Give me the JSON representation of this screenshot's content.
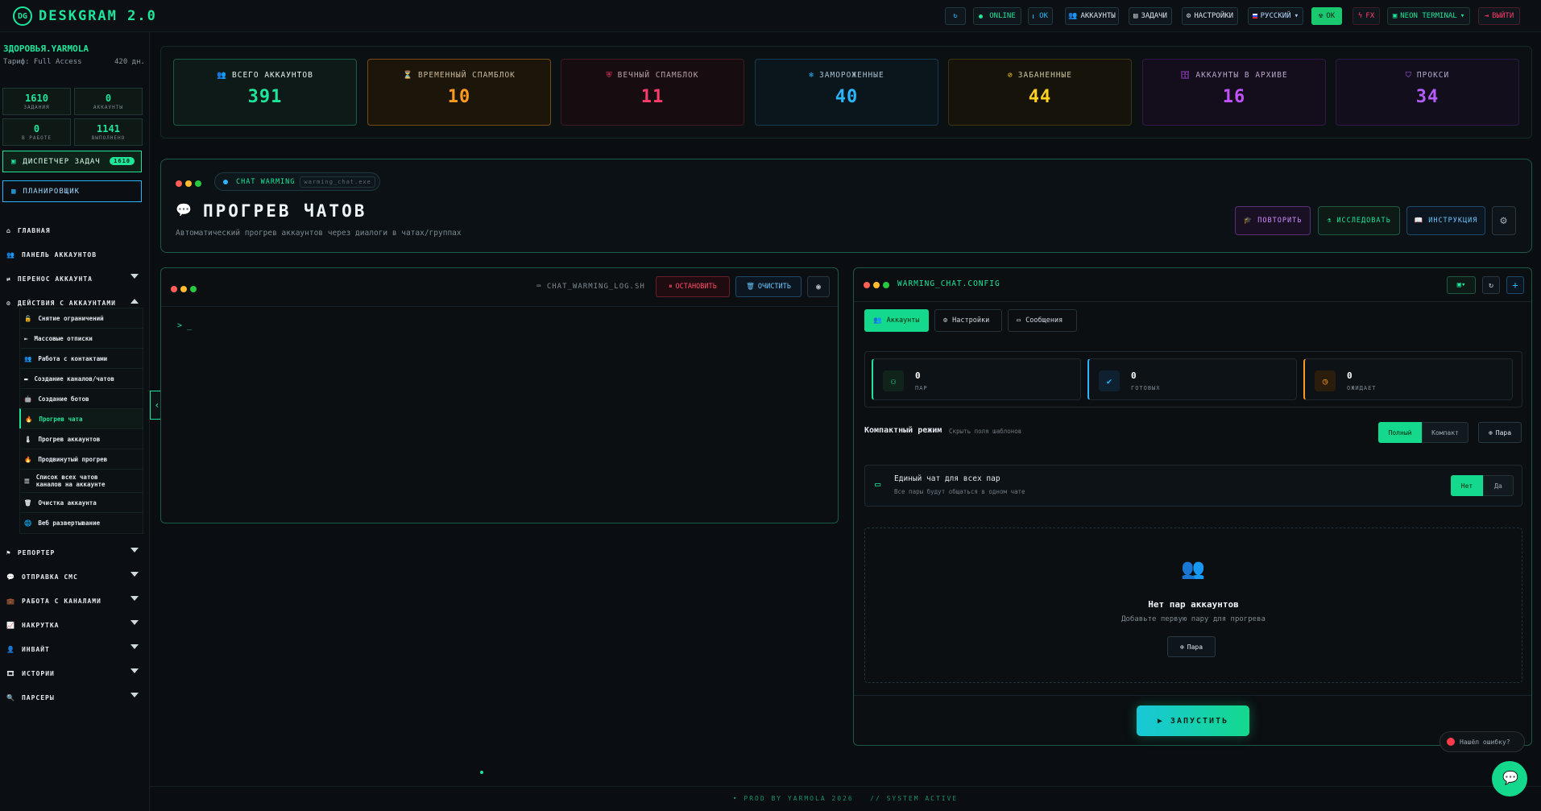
{
  "app": {
    "logo_mark": "DG",
    "title": "DESKGRAM 2.0"
  },
  "topbar": {
    "online": "ONLINE",
    "ok": "OK",
    "accounts": "АККАУНТЫ",
    "tasks": "ЗАДАЧИ",
    "settings": "НАСТРОЙКИ",
    "language": "РУССКИЙ",
    "ok2": "OK",
    "fx": "FX",
    "theme": "NEON TERMINAL",
    "logout": "ВЫЙТИ"
  },
  "sidebar": {
    "user": "ЗДОРОВЬЯ.YARMOLA",
    "tariff": "Тариф: Full Access",
    "days": "420 дн.",
    "stats": [
      {
        "value": "1610",
        "label": "ЗАДАНИЯ"
      },
      {
        "value": "0",
        "label": "АККАУНТЫ"
      },
      {
        "value": "0",
        "label": "В РАБОТЕ"
      },
      {
        "value": "1141",
        "label": "ВЫПОЛНЕНО"
      }
    ],
    "task_manager": "ДИСПЕТЧЕР ЗАДАЧ",
    "task_count": "1610",
    "scheduler": "ПЛАНИРОВЩИК",
    "nav_top": [
      {
        "label": "ГЛАВНАЯ"
      },
      {
        "label": "ПАНЕЛЬ АККАУНТОВ"
      },
      {
        "label": "ПЕРЕНОС АККАУНТА"
      },
      {
        "label": "ДЕЙСТВИЯ С АККАУНТАМИ"
      }
    ],
    "sub_items": [
      "Снятие ограничений",
      "Массовые отписки",
      "Работа с контактами",
      "Создание каналов/чатов",
      "Создание ботов",
      "Прогрев чата",
      "Прогрев аккаунтов",
      "Продвинутый прогрев",
      "Список всех чатов\nканалов на аккаунте",
      "Очистка аккаунта",
      "Веб развертывание"
    ],
    "nav_bottom": [
      {
        "label": "РЕПОРТЕР"
      },
      {
        "label": "ОТПРАВКА СМС"
      },
      {
        "label": "РАБОТА С КАНАЛАМИ"
      },
      {
        "label": "НАКРУТКА"
      },
      {
        "label": "ИНВАЙТ"
      },
      {
        "label": "ИСТОРИИ"
      },
      {
        "label": "ПАРСЕРЫ"
      }
    ]
  },
  "cards": [
    {
      "title": "ВСЕГО АККАУНТОВ",
      "value": "391",
      "color": "#1ee59a"
    },
    {
      "title": "ВРЕМЕННЫЙ СПАМБЛОК",
      "value": "10",
      "color": "#ff9a1f"
    },
    {
      "title": "ВЕЧНЫЙ СПАМБЛОК",
      "value": "11",
      "color": "#ff3b6b"
    },
    {
      "title": "ЗАМОРОЖЕННЫЕ",
      "value": "40",
      "color": "#29b6ff"
    },
    {
      "title": "ЗАБАНЕННЫЕ",
      "value": "44",
      "color": "#ffd21f"
    },
    {
      "title": "АККАУНТЫ В АРХИВЕ",
      "value": "16",
      "color": "#c451ff"
    },
    {
      "title": "ПРОКСИ",
      "value": "34",
      "color": "#b45cff"
    }
  ],
  "hero": {
    "badge": "CHAT WARMING",
    "badge_file": "warming_chat.exe",
    "title": "ПРОГРЕВ ЧАТОВ",
    "subtitle": "Автоматический прогрев аккаунтов через диалоги в чатах/группах",
    "repeat": "ПОВТОРИТЬ",
    "explore": "ИССЛЕДОВАТЬ",
    "guide": "ИНСТРУКЦИЯ"
  },
  "terminal": {
    "filename": "CHAT_WARMING_LOG.SH",
    "stop": "ОСТАНОВИТЬ",
    "clear": "ОЧИСТИТЬ",
    "prompt": "> _"
  },
  "config": {
    "filename": "WARMING_CHAT.CONFIG",
    "tabs": [
      "Аккаунты",
      "Настройки",
      "Сообщения"
    ],
    "stats": [
      {
        "value": "0",
        "label": "ПАР",
        "color": "#1ee59a"
      },
      {
        "value": "0",
        "label": "ГОТОВЫХ",
        "color": "#29b6ff"
      },
      {
        "value": "0",
        "label": "ОЖИДАЕТ",
        "color": "#ff9a1f"
      }
    ],
    "compact_label": "Компактный режим",
    "compact_hint": "Скрыть поля шаблонов",
    "mode_full": "Полный",
    "mode_compact": "Компакт",
    "add_pair": "Пара",
    "single_chat_title": "Единый чат для всех пар",
    "single_chat_desc": "Все пары будут общаться в одном чате",
    "no": "Нет",
    "yes": "Да",
    "empty_title": "Нет пар аккаунтов",
    "empty_desc": "Добавьте первую пару для прогрева",
    "empty_add": "Пара",
    "start": "ЗАПУСТИТЬ"
  },
  "footer": {
    "text": "• PROD BY YARMOLA 2026   // SYSTEM ACTIVE"
  },
  "error_report": "Нашёл ошибку?"
}
